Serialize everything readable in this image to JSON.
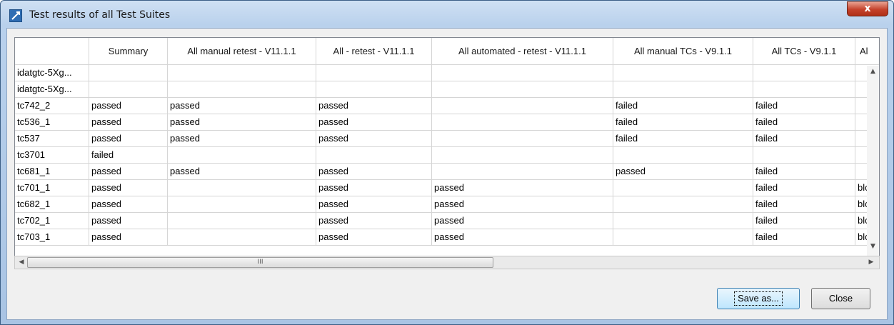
{
  "window": {
    "title": "Test results of all Test Suites",
    "close_glyph": "x"
  },
  "table": {
    "columns": [
      "",
      "Summary",
      "All manual retest - V11.1.1",
      "All - retest - V11.1.1",
      "All automated - retest - V11.1.1",
      "All manual TCs - V9.1.1",
      "All TCs - V9.1.1",
      "Al"
    ],
    "rows": [
      [
        "idatgtc-5Xg...",
        "",
        "",
        "",
        "",
        "",
        "",
        ""
      ],
      [
        "idatgtc-5Xg...",
        "",
        "",
        "",
        "",
        "",
        "",
        ""
      ],
      [
        "tc742_2",
        "passed",
        "passed",
        "passed",
        "",
        "failed",
        "failed",
        ""
      ],
      [
        "tc536_1",
        "passed",
        "passed",
        "passed",
        "",
        "failed",
        "failed",
        ""
      ],
      [
        "tc537",
        "passed",
        "passed",
        "passed",
        "",
        "failed",
        "failed",
        ""
      ],
      [
        "tc3701",
        "failed",
        "",
        "",
        "",
        "",
        "",
        ""
      ],
      [
        "tc681_1",
        "passed",
        "passed",
        "passed",
        "",
        "passed",
        "failed",
        ""
      ],
      [
        "tc701_1",
        "passed",
        "",
        "passed",
        "passed",
        "",
        "failed",
        "blc"
      ],
      [
        "tc682_1",
        "passed",
        "",
        "passed",
        "passed",
        "",
        "failed",
        "blc"
      ],
      [
        "tc702_1",
        "passed",
        "",
        "passed",
        "passed",
        "",
        "failed",
        "blc"
      ],
      [
        "tc703_1",
        "passed",
        "",
        "passed",
        "passed",
        "",
        "failed",
        "blc"
      ]
    ]
  },
  "scrollbar": {
    "thumb_grip": "III"
  },
  "buttons": {
    "save_as": "Save as...",
    "close": "Close"
  }
}
